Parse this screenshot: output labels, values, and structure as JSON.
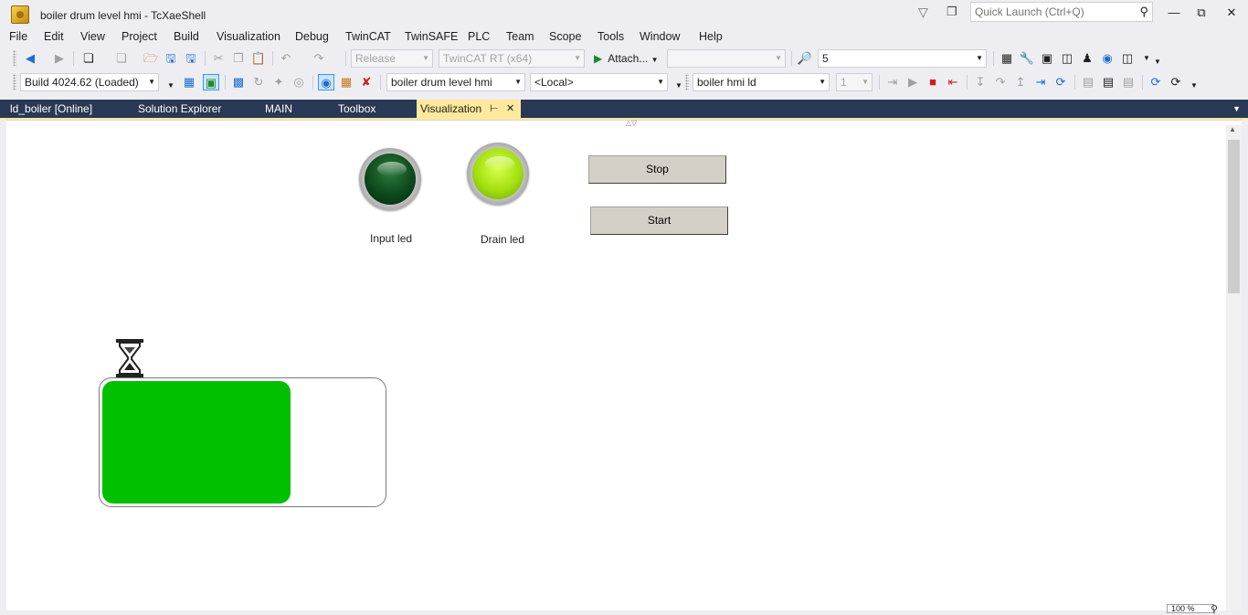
{
  "window": {
    "title": "boiler drum level hmi - TcXaeShell",
    "quick_launch_placeholder": "Quick Launch (Ctrl+Q)"
  },
  "menu": [
    "File",
    "Edit",
    "View",
    "Project",
    "Build",
    "Visualization",
    "Debug",
    "TwinCAT",
    "TwinSAFE",
    "PLC",
    "Team",
    "Scope",
    "Tools",
    "Window",
    "Help"
  ],
  "toolbar1": {
    "config_combo": "Release",
    "platform_combo": "TwinCAT RT (x64)",
    "attach_label": "Attach...",
    "attach_target_combo": "",
    "find_combo": "5"
  },
  "toolbar2": {
    "build_combo": "Build 4024.62 (Loaded)",
    "project_combo": "boiler drum level hmi",
    "target_combo": "<Local>",
    "plc_combo": "boiler hmi ld",
    "instance_combo": "1"
  },
  "tabs": [
    {
      "label": "ld_boiler [Online]",
      "active": false
    },
    {
      "label": "Solution Explorer",
      "active": false
    },
    {
      "label": "MAIN",
      "active": false
    },
    {
      "label": "Toolbox",
      "active": false
    },
    {
      "label": "Visualization",
      "active": true
    }
  ],
  "hmi": {
    "input_led": {
      "label": "Input led",
      "state": "off"
    },
    "drain_led": {
      "label": "Drain led",
      "state": "on"
    },
    "stop_label": "Stop",
    "start_label": "Start",
    "tank_level": 0.67,
    "tank_color": "#00c000"
  },
  "status": {
    "zoom": "100 %"
  },
  "colors": {
    "tab_strip": "#293955",
    "active_tab": "#ffe99c"
  }
}
